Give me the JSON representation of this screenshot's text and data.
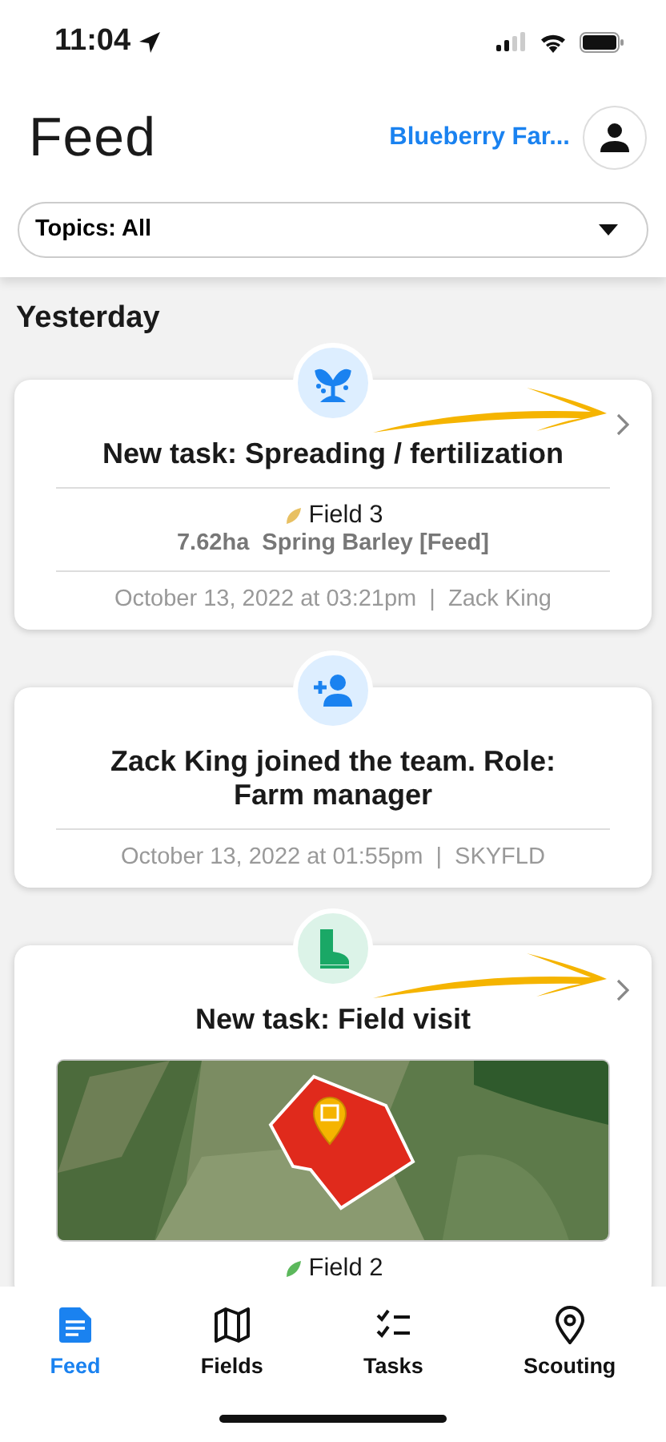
{
  "status_bar": {
    "time": "11:04"
  },
  "header": {
    "title": "Feed",
    "farm": "Blueberry Far...",
    "filter": "Topics: All"
  },
  "section": "Yesterday",
  "feed": [
    {
      "kind": "spreading",
      "highlighted": true,
      "title": "New task: Spreading / fertilization",
      "field": {
        "name": "Field 3",
        "details": "7.62ha  Spring Barley [Feed]"
      },
      "meta": "October 13, 2022 at 03:21pm  |  Zack King"
    },
    {
      "kind": "member",
      "highlighted": false,
      "title": "Zack King joined the team. Role: Farm manager",
      "meta": "October 13, 2022 at 01:55pm  |  SKYFLD"
    },
    {
      "kind": "visit",
      "highlighted": true,
      "title": "New task: Field visit",
      "field": {
        "name": "Field 2"
      }
    }
  ],
  "tabs": [
    {
      "label": "Feed",
      "selected": true
    },
    {
      "label": "Fields",
      "selected": false
    },
    {
      "label": "Tasks",
      "selected": false
    },
    {
      "label": "Scouting",
      "selected": false
    }
  ]
}
